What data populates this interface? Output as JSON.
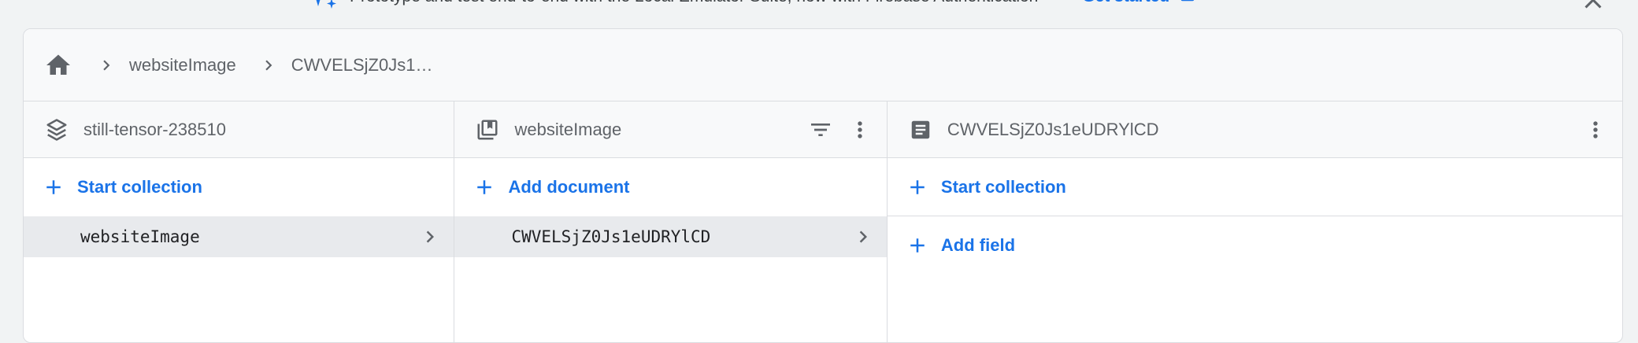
{
  "banner": {
    "text": "Prototype and test end-to-end with the Local Emulator Suite, now with Firebase Authentication",
    "cta_label": "Get started",
    "icons": [
      "sparkle-icon",
      "open-in-new-icon",
      "close-icon"
    ]
  },
  "breadcrumb": {
    "items": [
      "websiteImage",
      "CWVELSjZ0Js1…"
    ],
    "icons": [
      "home-icon",
      "chevron-right-icon"
    ]
  },
  "columns": [
    {
      "header": "still-tensor-238510",
      "header_icon": "project-stack-icon",
      "action": "Start collection",
      "items": [
        "websiteImage"
      ]
    },
    {
      "header": "websiteImage",
      "header_icon": "collection-icon",
      "action": "Add document",
      "items": [
        "CWVELSjZ0Js1eUDRYlCD"
      ]
    },
    {
      "header": "CWVELSjZ0Js1eUDRYlCD",
      "header_icon": "document-icon",
      "actions": [
        "Start collection",
        "Add field"
      ]
    }
  ],
  "colors": {
    "accent": "#1a73e8",
    "muted_text": "#5f6368",
    "selected_row": "#e8eaed",
    "header_bg": "#f8f9fa",
    "page_bg": "#f1f3f4"
  }
}
